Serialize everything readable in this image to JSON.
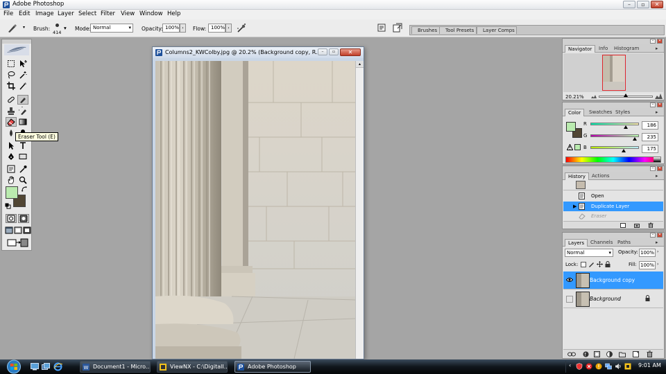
{
  "app": {
    "title": "Adobe Photoshop"
  },
  "menu": [
    "File",
    "Edit",
    "Image",
    "Layer",
    "Select",
    "Filter",
    "View",
    "Window",
    "Help"
  ],
  "options": {
    "brush_label": "Brush:",
    "brush_size": "414",
    "mode_label": "Mode:",
    "mode_value": "Normal",
    "opacity_label": "Opacity:",
    "opacity_value": "100%",
    "flow_label": "Flow:",
    "flow_value": "100%"
  },
  "palette_well": [
    "Brushes",
    "Tool Presets",
    "Layer Comps"
  ],
  "toolbox": {
    "tooltip": "Eraser Tool (E)",
    "foreground": "#baebaf",
    "background": "#514634"
  },
  "document": {
    "title": "Columns2_KWColby.jpg @ 20.2% (Background copy, R..."
  },
  "navigator": {
    "tabs": [
      "Navigator",
      "Info",
      "Histogram"
    ],
    "zoom": "20.21%",
    "zoom_level": 0.5
  },
  "color": {
    "tabs": [
      "Color",
      "Swatches",
      "Styles"
    ],
    "channels": [
      {
        "label": "R",
        "value": "186",
        "level": 0.73,
        "gradient": "linear-gradient(90deg,#00ebaf,#ffebaf)"
      },
      {
        "label": "G",
        "value": "235",
        "level": 0.92,
        "gradient": "linear-gradient(90deg,#ba00af,#baffaf)"
      },
      {
        "label": "B",
        "value": "175",
        "level": 0.69,
        "gradient": "linear-gradient(90deg,#baeb00,#baebff)"
      }
    ]
  },
  "history": {
    "tabs": [
      "History",
      "Actions"
    ],
    "steps": [
      "Open",
      "Duplicate Layer",
      "Eraser"
    ],
    "active_step": "Duplicate Layer"
  },
  "layers": {
    "tabs": [
      "Layers",
      "Channels",
      "Paths"
    ],
    "blend_mode": "Normal",
    "opacity_label": "Opacity:",
    "opacity": "100%",
    "lock_label": "Lock:",
    "fill_label": "Fill:",
    "fill": "100%",
    "items": [
      {
        "name": "Background copy",
        "selected": true,
        "visible": true
      },
      {
        "name": "Background",
        "selected": false,
        "visible": false
      }
    ]
  },
  "taskbar": {
    "buttons": [
      "Document1 - Micro...",
      "ViewNX - C:\\DigitalI...",
      "Adobe Photoshop"
    ],
    "clock": "9:01 AM"
  },
  "colors": {
    "selection": "#3399ff",
    "taskbar": "#0c1217"
  }
}
